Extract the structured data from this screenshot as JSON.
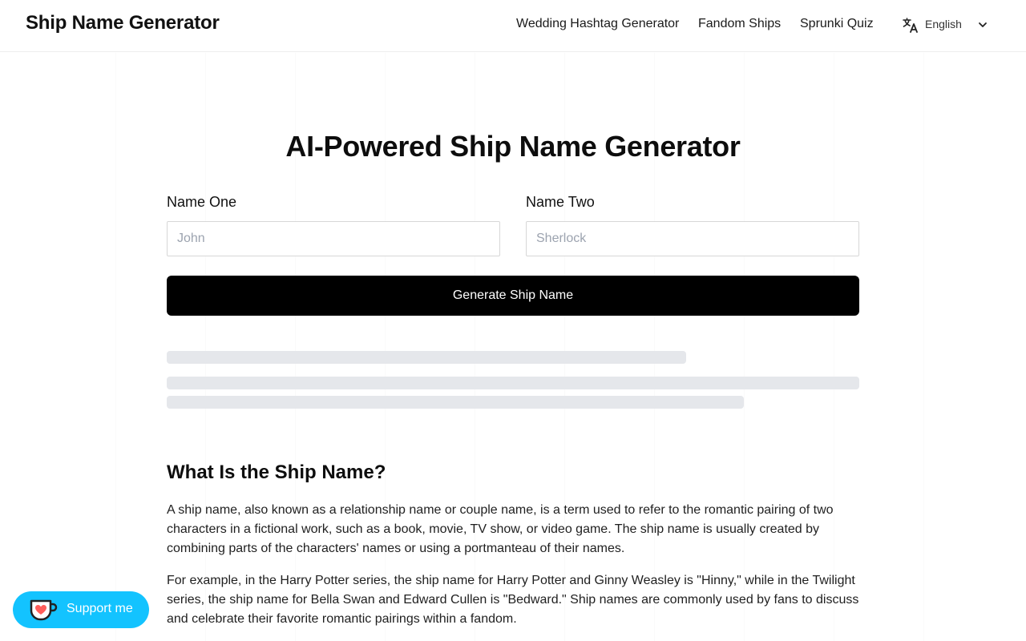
{
  "header": {
    "brand": "Ship Name Generator",
    "nav": [
      {
        "label": "Wedding Hashtag Generator"
      },
      {
        "label": "Fandom Ships"
      },
      {
        "label": "Sprunki Quiz"
      }
    ],
    "language": {
      "label": "English",
      "icon": "translate-icon"
    }
  },
  "main": {
    "title": "AI-Powered Ship Name Generator",
    "name_one": {
      "label": "Name One",
      "placeholder": "John",
      "value": ""
    },
    "name_two": {
      "label": "Name Two",
      "placeholder": "Sherlock",
      "value": ""
    },
    "generate_label": "Generate Ship Name"
  },
  "article": {
    "heading": "What Is the Ship Name?",
    "paragraphs": [
      "A ship name, also known as a relationship name or couple name, is a term used to refer to the romantic pairing of two characters in a fictional work, such as a book, movie, TV show, or video game. The ship name is usually created by combining parts of the characters' names or using a portmanteau of their names.",
      "For example, in the Harry Potter series, the ship name for Harry Potter and Ginny Weasley is \"Hinny,\" while in the Twilight series, the ship name for Bella Swan and Edward Cullen is \"Bedward.\" Ship names are commonly used by fans to discuss and celebrate their favorite romantic pairings within a fandom."
    ]
  },
  "support": {
    "label": "Support me",
    "icon": "coffee-cup-heart-icon"
  },
  "colors": {
    "accent": "#000000",
    "support_bg": "#13c3ff",
    "skeleton": "#e5e7eb"
  }
}
